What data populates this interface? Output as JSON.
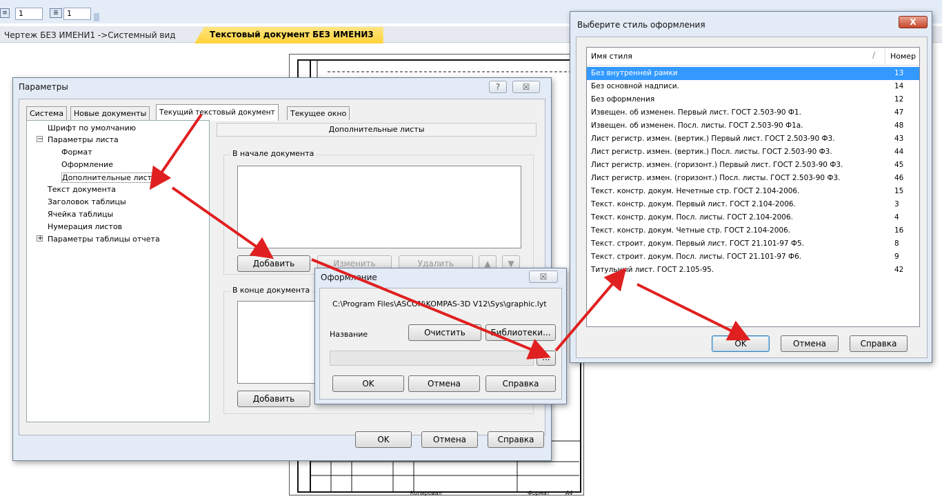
{
  "toolbar": {
    "field1_value": "1",
    "field2_value": "1"
  },
  "doc_tabs": {
    "tab1": "Чертеж БЕЗ ИМЕНИ1 ->Системный вид",
    "tab2": "Текстовый документ БЕЗ ИМЕНИ3"
  },
  "params_dialog": {
    "title": "Параметры",
    "help": "?",
    "close": "☒",
    "tabs": [
      "Система",
      "Новые документы",
      "Текущий текстовый документ",
      "Текущее окно"
    ],
    "tree": [
      "Шрифт по умолчанию",
      "Параметры листа",
      "Формат",
      "Оформление",
      "Дополнительные листы",
      "Текст документа",
      "Заголовок таблицы",
      "Ячейка таблицы",
      "Нумерация листов",
      "Параметры таблицы отчета"
    ],
    "section_header": "Дополнительные листы",
    "group_start": "В начале документа",
    "group_end": "В конце документа",
    "add": "Добавить",
    "edit": "Изменить",
    "delete": "Удалить",
    "add2": "Добавить",
    "ok": "OK",
    "cancel": "Отмена",
    "help_btn": "Справка"
  },
  "oformlenie_dialog": {
    "title": "Оформление",
    "close": "☒",
    "path": "C:\\Program Files\\ASCON\\KOMPAS-3D V12\\Sys\\graphic.lyt",
    "name_label": "Название",
    "clear": "Очистить",
    "libraries": "Библиотеки...",
    "browse": "...",
    "ok": "OK",
    "cancel": "Отмена",
    "help": "Справка"
  },
  "style_dialog": {
    "title": "Выберите стиль оформления",
    "close": "X",
    "col_name": "Имя стиля",
    "col_num": "Номер",
    "rows": [
      {
        "name": "Без внутренней рамки",
        "num": "13"
      },
      {
        "name": "Без основной надписи.",
        "num": "14"
      },
      {
        "name": "Без оформления",
        "num": "12"
      },
      {
        "name": "Извещен. об изменен. Первый лист. ГОСТ 2.503-90 Ф1.",
        "num": "47"
      },
      {
        "name": "Извещен. об изменен. Посл. листы. ГОСТ 2.503-90 Ф1а.",
        "num": "48"
      },
      {
        "name": "Лист регистр. измен. (вертик.) Первый лист. ГОСТ 2.503-90 Ф3.",
        "num": "43"
      },
      {
        "name": "Лист регистр. измен. (вертик.) Посл. листы. ГОСТ 2.503-90 Ф3.",
        "num": "44"
      },
      {
        "name": "Лист регистр. измен. (горизонт.) Первый лист. ГОСТ 2.503-90 Ф3.",
        "num": "45"
      },
      {
        "name": "Лист регистр. измен. (горизонт.) Посл. листы. ГОСТ 2.503-90 Ф3.",
        "num": "46"
      },
      {
        "name": "Текст. констр. докум. Нечетные стр. ГОСТ 2.104-2006.",
        "num": "15"
      },
      {
        "name": "Текст. констр. докум. Первый лист. ГОСТ 2.104-2006.",
        "num": "3"
      },
      {
        "name": "Текст. констр. докум. Посл. листы. ГОСТ 2.104-2006.",
        "num": "4"
      },
      {
        "name": "Текст. констр. докум. Четные стр. ГОСТ 2.104-2006.",
        "num": "16"
      },
      {
        "name": "Текст. строит. докум. Первый лист. ГОСТ 21.101-97 Ф5.",
        "num": "8"
      },
      {
        "name": "Текст. строит. докум. Посл. листы. ГОСТ 21.101-97 Ф6.",
        "num": "9"
      },
      {
        "name": "Титульный лист. ГОСТ 2.105-95.",
        "num": "42"
      }
    ],
    "ok": "OK",
    "cancel": "Отмена",
    "help": "Справка"
  },
  "drawing_stamp": {
    "text1": "Копировал",
    "text2": "Формат",
    "text3": "A4"
  }
}
